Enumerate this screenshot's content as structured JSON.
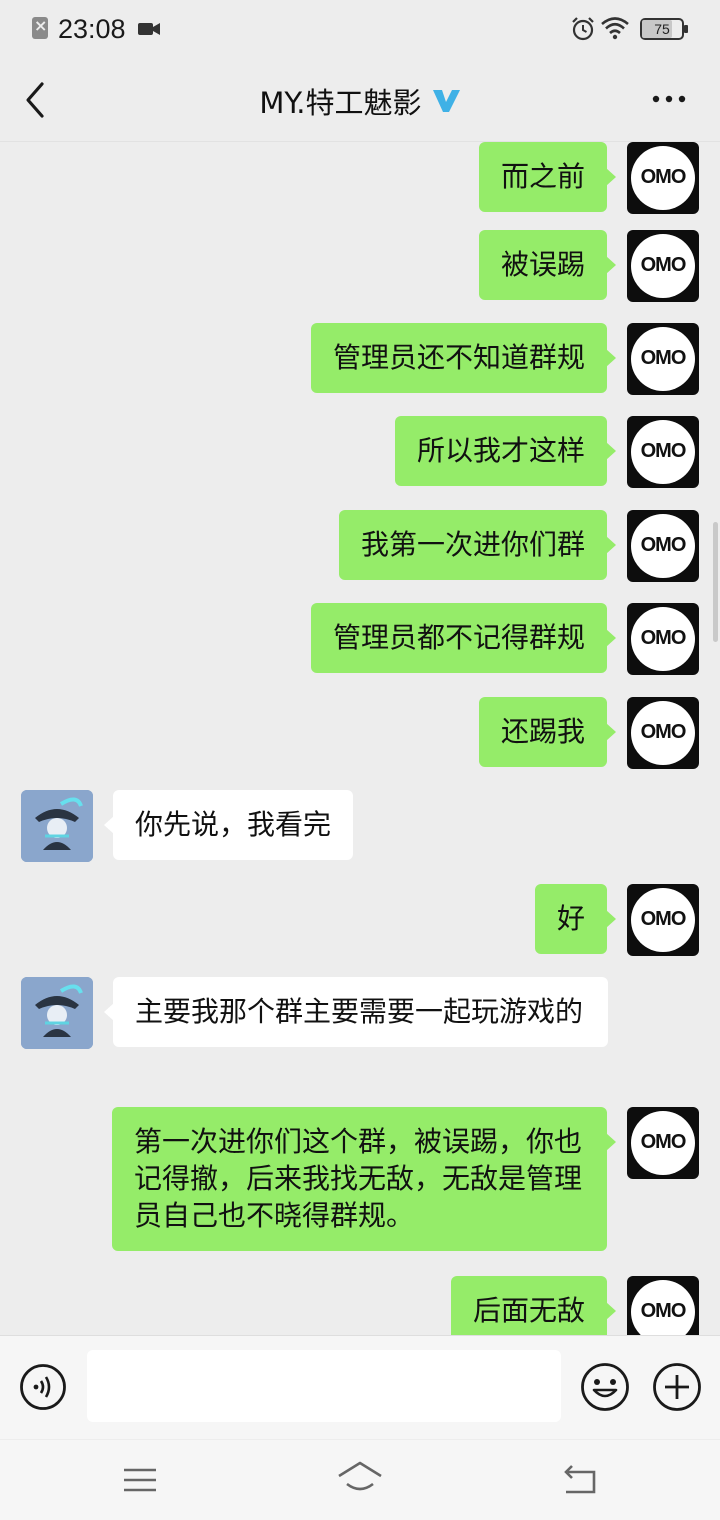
{
  "status_bar": {
    "time": "23:08",
    "battery": "75",
    "battery_level": 0.75,
    "icons": [
      "notification-icon",
      "video-camera-icon",
      "alarm-icon",
      "wifi-icon",
      "battery-icon"
    ]
  },
  "header": {
    "title": "MY.特工魅影",
    "verified_badge": "verified-v-icon",
    "back_icon": "chevron-left-icon",
    "more_icon": "more-dots-icon"
  },
  "messages": [
    {
      "side": "mine",
      "text": "而之前"
    },
    {
      "side": "mine",
      "text": "被误踢"
    },
    {
      "side": "mine",
      "text": "管理员还不知道群规"
    },
    {
      "side": "mine",
      "text": "所以我才这样"
    },
    {
      "side": "mine",
      "text": "我第一次进你们群"
    },
    {
      "side": "mine",
      "text": "管理员都不记得群规"
    },
    {
      "side": "mine",
      "text": "还踢我"
    },
    {
      "side": "theirs",
      "text": "你先说，我看完"
    },
    {
      "side": "mine",
      "text": "好"
    },
    {
      "side": "theirs",
      "text": "主要我那个群主要需要一起玩游戏的"
    },
    {
      "side": "mine",
      "text": "第一次进你们这个群，被误踢，你也记得撤，后来我找无敌，无敌是管理员自己也不晓得群规。"
    },
    {
      "side": "mine",
      "text": "后面无敌"
    }
  ],
  "avatars": {
    "mine_text": "OMO"
  },
  "input_bar": {
    "placeholder": "",
    "icons": [
      "voice-icon",
      "emoji-icon",
      "plus-icon"
    ]
  },
  "nav_bar": {
    "icons": [
      "menu-icon",
      "home-icon",
      "back-icon"
    ]
  },
  "colors": {
    "mine_bubble": "#95ec69",
    "theirs_bubble": "#ffffff",
    "background": "#ededed",
    "verified": "#3fb1e6"
  }
}
